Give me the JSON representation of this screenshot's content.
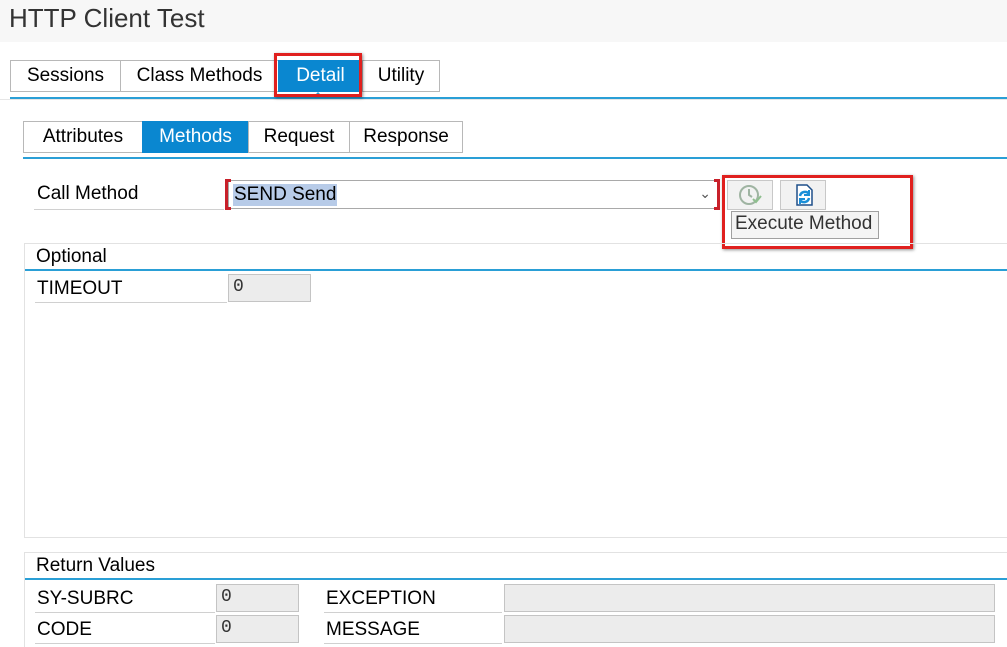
{
  "window": {
    "title": "HTTP Client Test"
  },
  "outer_tabs": [
    "Sessions",
    "Class Methods",
    "Detail",
    "Utility"
  ],
  "inner_tabs": [
    "Attributes",
    "Methods",
    "Request",
    "Response"
  ],
  "call_method": {
    "label": "Call Method",
    "value": "SEND Send"
  },
  "toolbar": {
    "tooltip": "Execute Method"
  },
  "optional": {
    "title": "Optional",
    "params": [
      {
        "name": "TIMEOUT",
        "value": "0"
      }
    ]
  },
  "return_values": {
    "title": "Return Values",
    "fields": {
      "sy_subrc": {
        "label": "SY-SUBRC",
        "value": "0"
      },
      "code": {
        "label": "CODE",
        "value": "0"
      },
      "exception": {
        "label": "EXCEPTION",
        "value": ""
      },
      "message": {
        "label": "MESSAGE",
        "value": ""
      }
    }
  },
  "colors": {
    "accent": "#0a87d0",
    "highlight": "#e0201e"
  }
}
